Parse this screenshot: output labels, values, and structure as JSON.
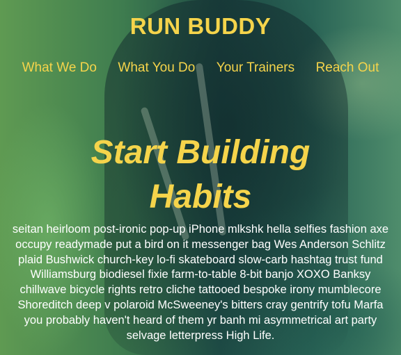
{
  "site": {
    "logo": "RUN BUDDY"
  },
  "nav": {
    "items": [
      {
        "label": "What We Do"
      },
      {
        "label": "What You Do"
      },
      {
        "label": "Your Trainers"
      },
      {
        "label": "Reach Out"
      }
    ]
  },
  "hero": {
    "title": "Start Building Habits",
    "body": "seitan heirloom post-ironic pop-up iPhone mlkshk hella selfies fashion axe occupy readymade put a bird on it messenger bag Wes Anderson Schlitz plaid Bushwick church-key lo-fi skateboard slow-carb hashtag trust fund Williamsburg biodiesel fixie farm-to-table 8-bit banjo XOXO Banksy chillwave bicycle rights retro cliche tattooed bespoke irony mumblecore Shoreditch deep v polaroid McSweeney's bitters cray gentrify tofu Marfa you probably haven't heard of them yr banh mi asymmetrical art party selvage letterpress High Life."
  },
  "colors": {
    "accent": "#f5d44b",
    "text": "#ffffff"
  }
}
